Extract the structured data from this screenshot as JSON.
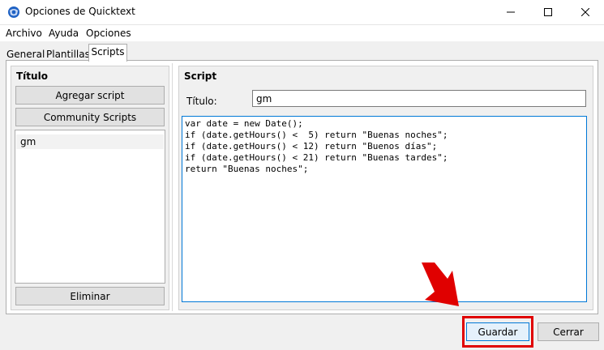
{
  "window": {
    "title": "Opciones de Quicktext",
    "controls": {
      "minimize_icon": "minimize-icon",
      "maximize_icon": "maximize-icon",
      "close_icon": "close-icon"
    }
  },
  "menu": [
    "Archivo",
    "Ayuda",
    "Opciones"
  ],
  "tabs": [
    {
      "label": "General",
      "active": false
    },
    {
      "label": "Plantillas",
      "active": false
    },
    {
      "label": "Scripts",
      "active": true
    }
  ],
  "left_panel": {
    "heading": "Título",
    "add_button": "Agregar script",
    "community_button": "Community Scripts",
    "scripts": [
      "gm"
    ],
    "delete_button": "Eliminar"
  },
  "right_panel": {
    "heading": "Script",
    "title_label": "Título:",
    "title_value": "gm",
    "code": "var date = new Date();\nif (date.getHours() <  5) return \"Buenas noches\";\nif (date.getHours() < 12) return \"Buenos días\";\nif (date.getHours() < 21) return \"Buenas tardes\";\nreturn \"Buenas noches\";"
  },
  "footer": {
    "save_button": "Guardar",
    "close_button": "Cerrar"
  },
  "annotation": {
    "highlight_color": "#e00000",
    "arrow_icon": "red-arrow-icon"
  }
}
